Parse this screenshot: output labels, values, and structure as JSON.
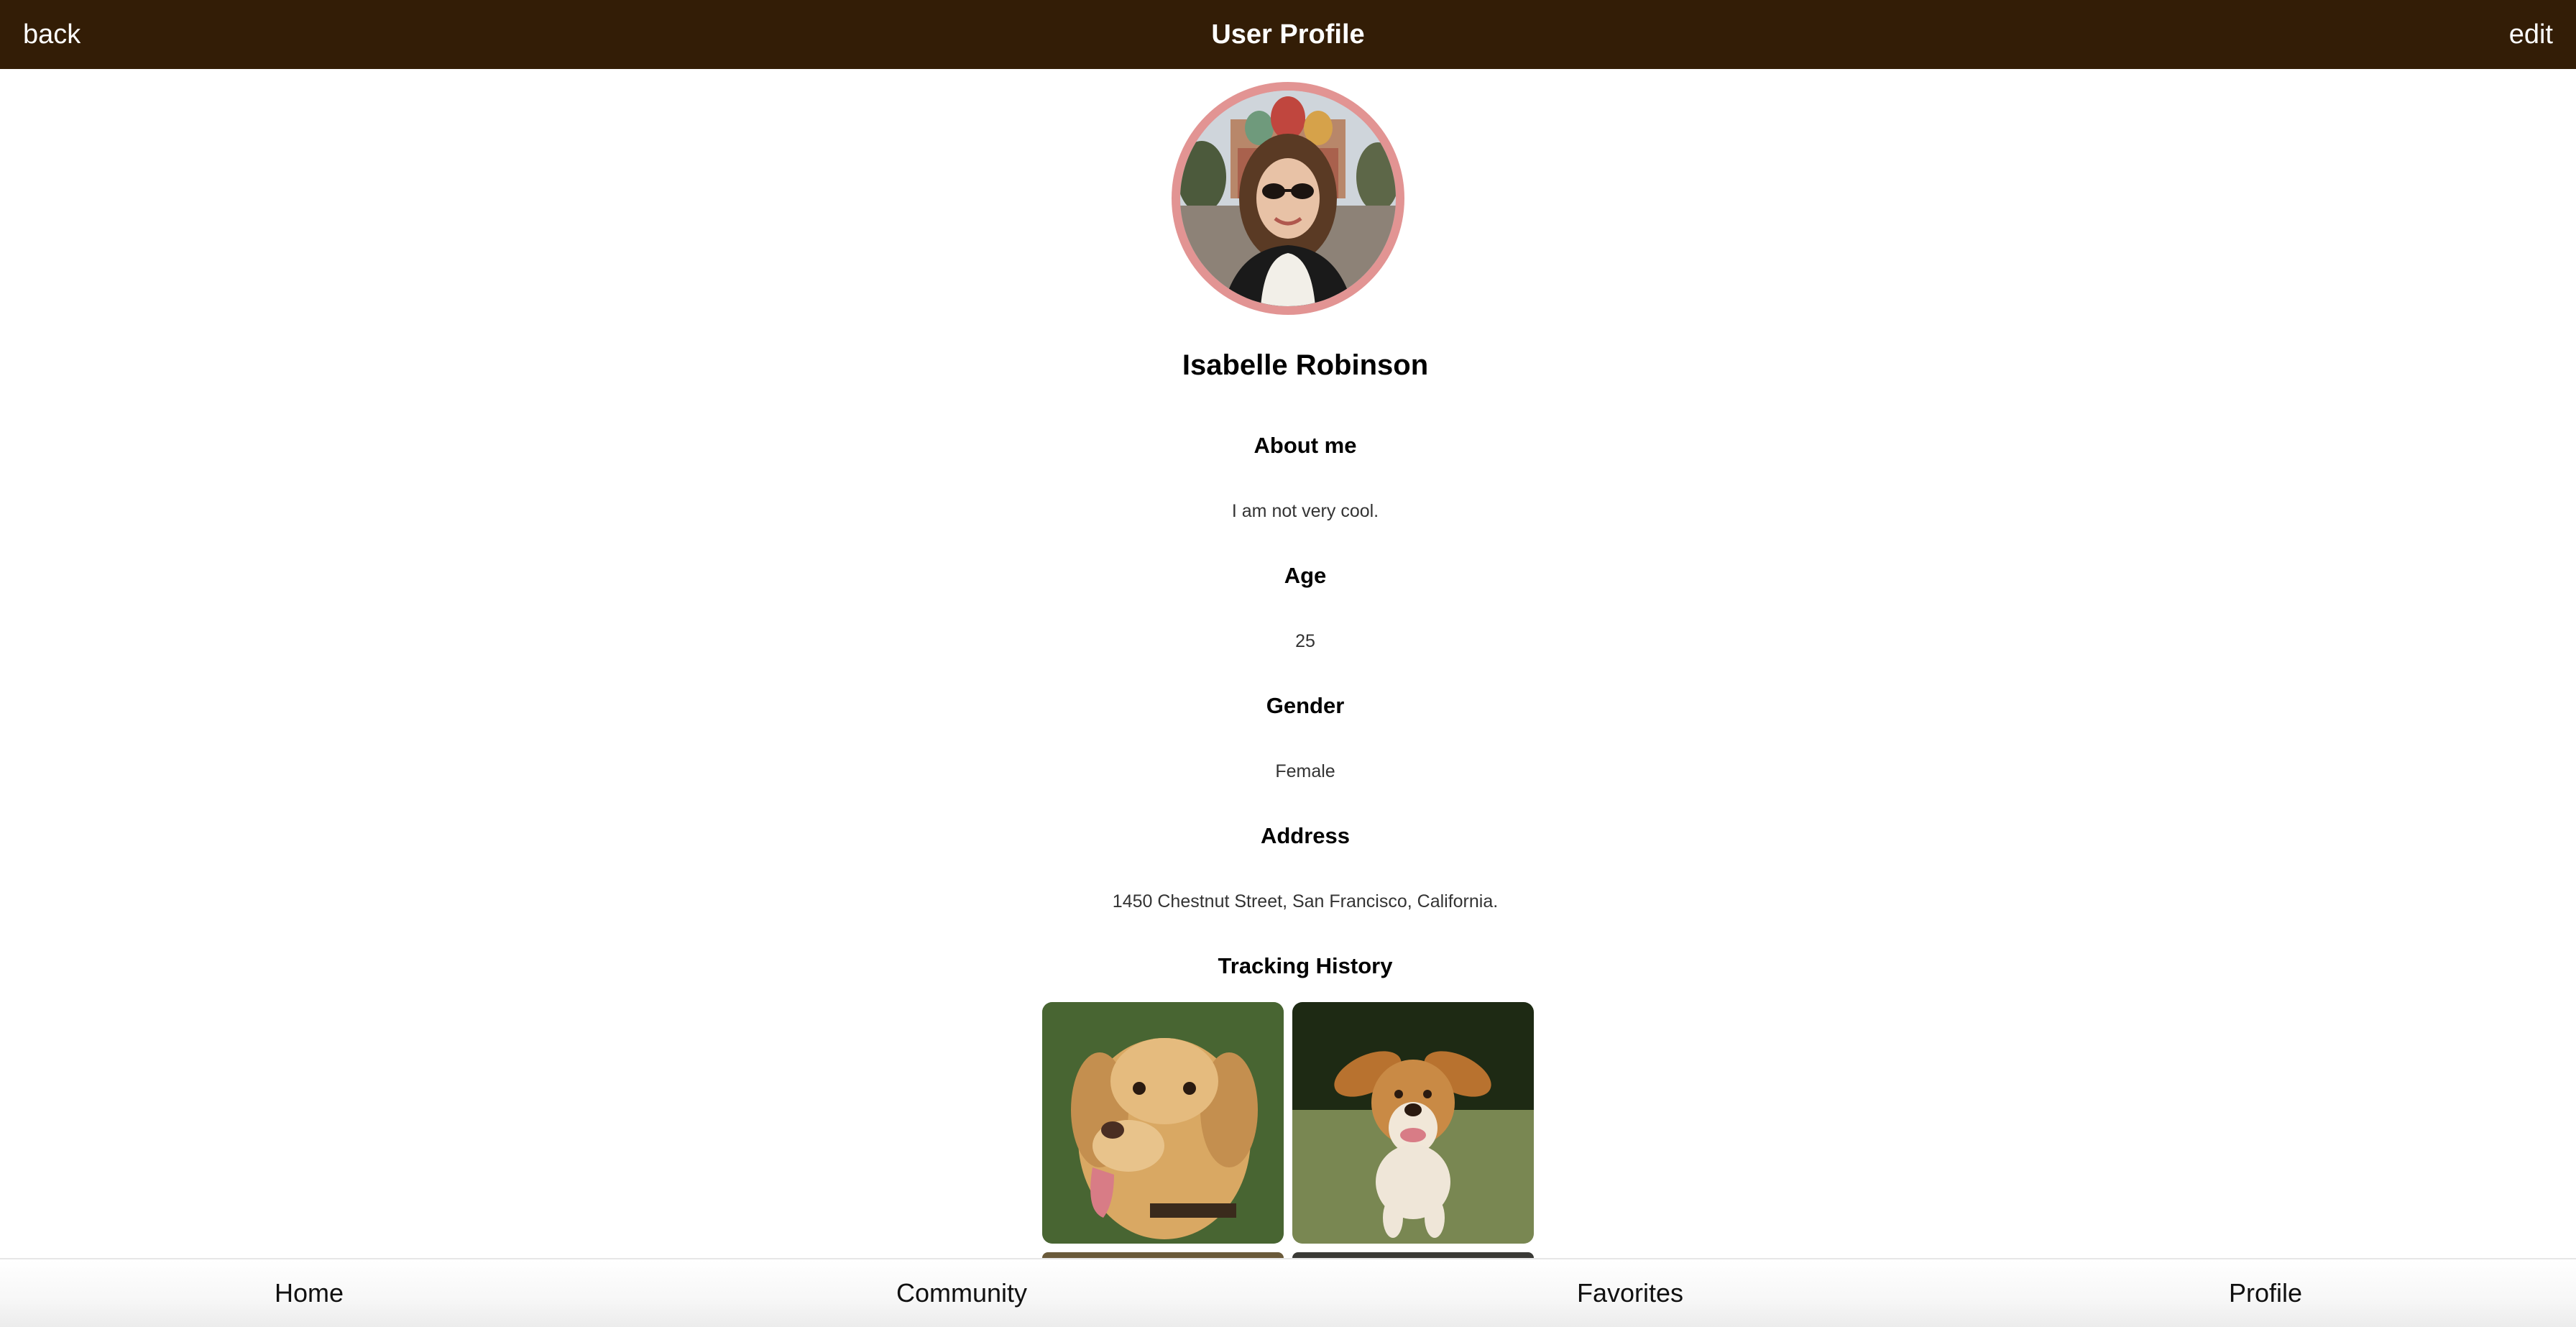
{
  "header": {
    "back_label": "back",
    "title": "User Profile",
    "edit_label": "edit",
    "background": "#331d06"
  },
  "profile": {
    "name": "Isabelle Robinson",
    "avatar_ring_color": "#e29493",
    "fields": [
      {
        "label": "About me",
        "value": "I am not very cool."
      },
      {
        "label": "Age",
        "value": "25"
      },
      {
        "label": "Gender",
        "value": "Female"
      },
      {
        "label": "Address",
        "value": "1450 Chestnut Street, San Francisco, California."
      }
    ]
  },
  "tracking_history": {
    "title": "Tracking History"
  },
  "bottom_nav": {
    "items": [
      {
        "label": "Home"
      },
      {
        "label": "Community"
      },
      {
        "label": "Favorites"
      },
      {
        "label": "Profile"
      }
    ]
  }
}
